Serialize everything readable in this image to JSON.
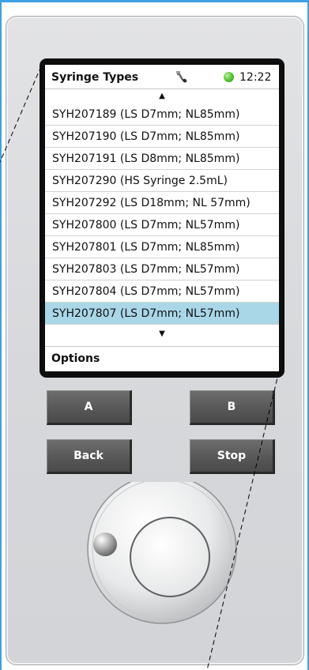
{
  "screen": {
    "title": "Syringe Types",
    "clock": "12:22",
    "scroll_up_glyph": "▲",
    "scroll_down_glyph": "▼",
    "items": [
      {
        "label": "SYH207189 (LS D7mm; NL85mm)",
        "selected": false
      },
      {
        "label": "SYH207190 (LS D7mm; NL85mm)",
        "selected": false
      },
      {
        "label": "SYH207191 (LS D8mm; NL85mm)",
        "selected": false
      },
      {
        "label": "SYH207290 (HS Syringe 2.5mL)",
        "selected": false
      },
      {
        "label": "SYH207292 (LS D18mm; NL 57mm)",
        "selected": false
      },
      {
        "label": "SYH207800 (LS D7mm; NL57mm)",
        "selected": false
      },
      {
        "label": "SYH207801 (LS D7mm; NL85mm)",
        "selected": false
      },
      {
        "label": "SYH207803 (LS D7mm; NL57mm)",
        "selected": false
      },
      {
        "label": "SYH207804 (LS D7mm; NL57mm)",
        "selected": false
      },
      {
        "label": "SYH207807 (LS D7mm; NL57mm)",
        "selected": true
      }
    ],
    "options_label": "Options",
    "icons": {
      "tool": "wrench-icon",
      "status": "status-led-icon"
    }
  },
  "buttons": {
    "a_label": "A",
    "b_label": "B",
    "back_label": "Back",
    "stop_label": "Stop"
  },
  "colors": {
    "selected_row": "#a9d7e8",
    "status_led": "#5ccb38",
    "button_face": "#5a5a5a",
    "device_body": "#d8dadc",
    "frame_accent": "#3e9fe3"
  }
}
